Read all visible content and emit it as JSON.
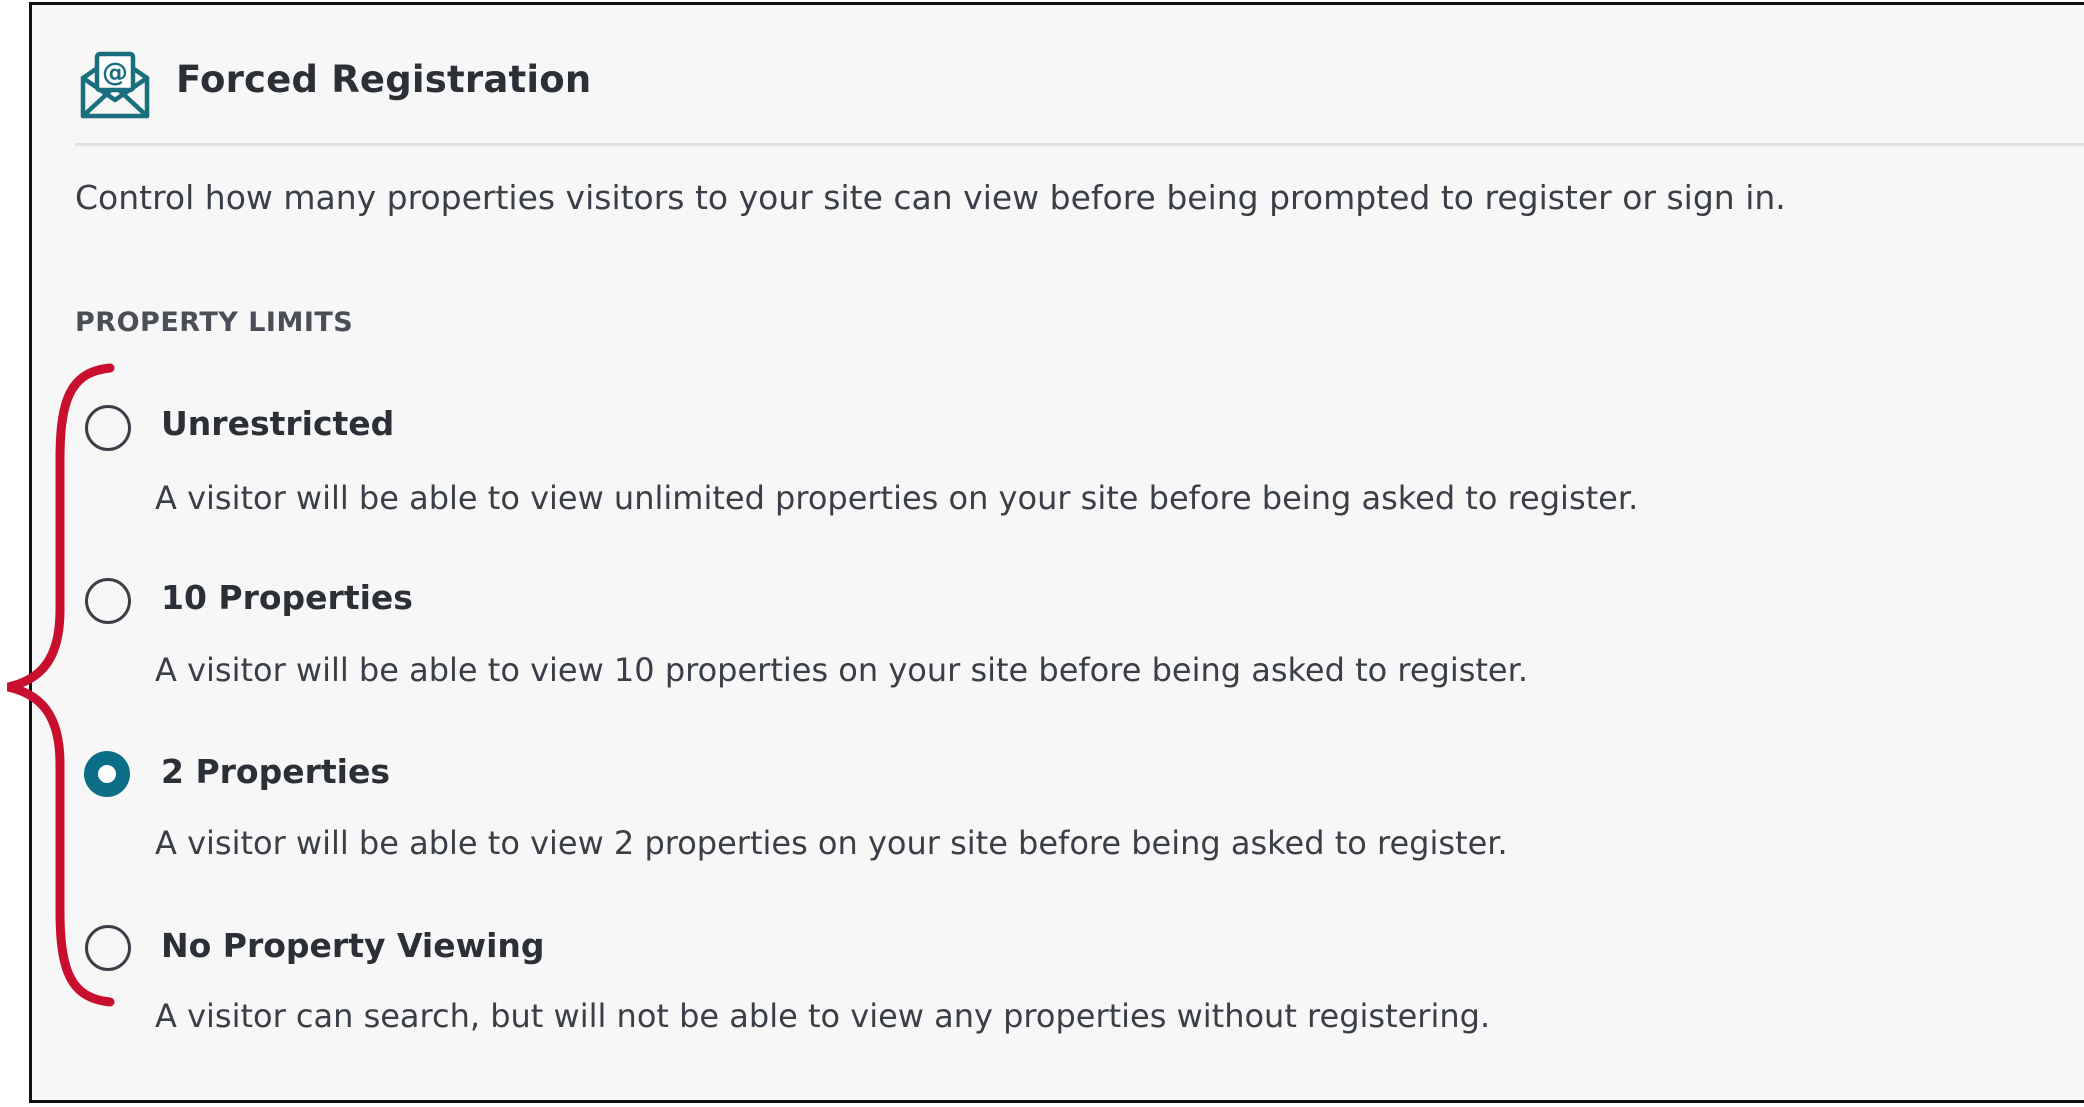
{
  "header": {
    "title": "Forced Registration",
    "icon": "envelope-at-icon",
    "accent_color": "#1a6f7e"
  },
  "description": "Control how many properties visitors to your site can view before being prompted to register or sign in.",
  "section": {
    "label": "PROPERTY LIMITS"
  },
  "options": [
    {
      "label": "Unrestricted",
      "description": "A visitor will be able to view unlimited properties on your site before being asked to register.",
      "selected": false
    },
    {
      "label": "10 Properties",
      "description": "A visitor will be able to view 10 properties on your site before being asked to register.",
      "selected": false
    },
    {
      "label": "2 Properties",
      "description": "A visitor will be able to view 2 properties on your site before being asked to register.",
      "selected": true
    },
    {
      "label": "No Property Viewing",
      "description": "A visitor can search, but will not be able to view any properties without registering.",
      "selected": false
    }
  ],
  "colors": {
    "radio_selected": "#0c6d86",
    "annotation_brace": "#c8102e"
  }
}
